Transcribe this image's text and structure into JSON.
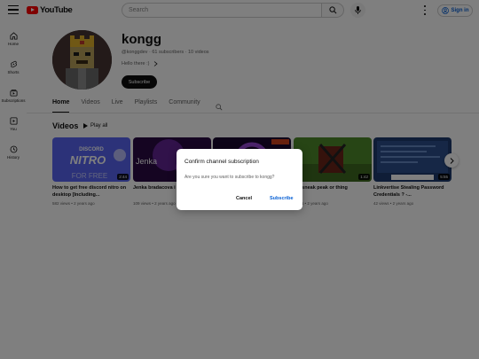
{
  "header": {
    "logo_text": "YouTube",
    "search_placeholder": "Search",
    "signin_label": "Sign in",
    "icons": [
      "menu-icon",
      "search-icon",
      "mic-icon",
      "more-vert-icon",
      "account-icon"
    ]
  },
  "sidebar": {
    "items": [
      {
        "label": "Home",
        "icon": "home-icon"
      },
      {
        "label": "Shorts",
        "icon": "shorts-icon"
      },
      {
        "label": "Subscriptions",
        "icon": "subscriptions-icon"
      },
      {
        "label": "You",
        "icon": "you-icon"
      },
      {
        "label": "History",
        "icon": "history-icon"
      }
    ]
  },
  "channel": {
    "name": "kongg",
    "handle": "@konggdev",
    "subscribers": "61 subscribers",
    "videos": "10 videos",
    "description": "Hello there :)",
    "subscribe_label": "Subscribe"
  },
  "tabs": {
    "items": [
      "Home",
      "Videos",
      "Live",
      "Playlists",
      "Community"
    ],
    "active": "Home"
  },
  "videos_section": {
    "title": "Videos",
    "play_all_label": "Play all",
    "items": [
      {
        "title": "How to get free discord nitro on desktop [Including...",
        "duration": "2:44",
        "views": "582 views",
        "age": "2 years ago",
        "thumb_text": "DISCORD NITRO FOR FREE"
      },
      {
        "title": "Jenka bradacova i",
        "duration": "",
        "views": "109 views",
        "age": "2 years ago",
        "thumb_text": "Jenka"
      },
      {
        "title": "",
        "duration": "",
        "views": "",
        "age": "",
        "thumb_text": ""
      },
      {
        "title": "ED sneak peak or thing",
        "duration": "1:42",
        "views": "views",
        "age": "2 years ago",
        "thumb_text": ""
      },
      {
        "title": "Linkvertise Stealing Password Credentials ? -...",
        "duration": "5:55",
        "views": "42 views",
        "age": "2 years ago",
        "thumb_text": ""
      }
    ]
  },
  "dialog": {
    "title": "Confirm channel subscription",
    "message": "Are you sure you want to subscribe to kongg?",
    "cancel_label": "Cancel",
    "confirm_label": "Subscribe"
  },
  "colors": {
    "brand_red": "#ff0000",
    "link_blue": "#065fd4",
    "overlay": "rgba(0,0,0,0.5)"
  }
}
